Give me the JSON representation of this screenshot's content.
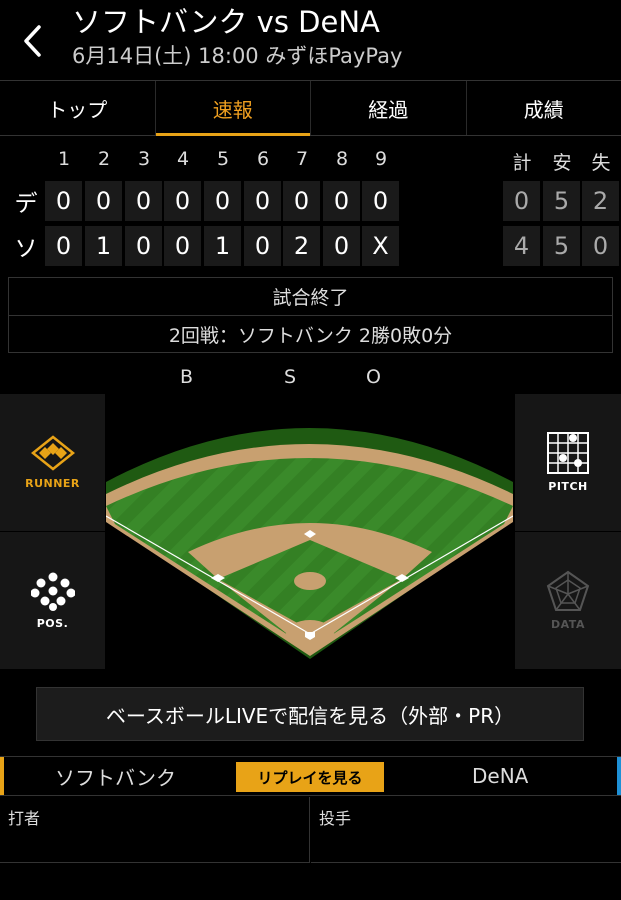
{
  "header": {
    "title": "ソフトバンク vs DeNA",
    "subtitle": "6月14日(土) 18:00 みずほPayPay"
  },
  "tabs": [
    {
      "label": "トップ",
      "active": false
    },
    {
      "label": "速報",
      "active": true
    },
    {
      "label": "経過",
      "active": false
    },
    {
      "label": "成績",
      "active": false
    }
  ],
  "scoreboard": {
    "innings": [
      "1",
      "2",
      "3",
      "4",
      "5",
      "6",
      "7",
      "8",
      "9"
    ],
    "totals_headers": [
      "計",
      "安",
      "失"
    ],
    "teams": [
      {
        "abbr": "デ",
        "scores": [
          "0",
          "0",
          "0",
          "0",
          "0",
          "0",
          "0",
          "0",
          "0"
        ],
        "totals": [
          "0",
          "5",
          "2"
        ]
      },
      {
        "abbr": "ソ",
        "scores": [
          "0",
          "1",
          "0",
          "0",
          "1",
          "0",
          "2",
          "0",
          "X"
        ],
        "totals": [
          "4",
          "5",
          "0"
        ]
      }
    ]
  },
  "status": {
    "line1": "試合終了",
    "line2": "2回戦：ソフトバンク 2勝0敗0分"
  },
  "bso": {
    "b": "B",
    "s": "S",
    "o": "O"
  },
  "side_buttons": {
    "runner": "RUNNER",
    "pitch": "PITCH",
    "pos": "POS.",
    "data": "DATA"
  },
  "live_button": "ベースボールLIVEで配信を見る（外部・PR）",
  "teams_bar": {
    "home": "ソフトバンク",
    "replay": "リプレイを見る",
    "away": "DeNA"
  },
  "batter_pitcher": {
    "batter": "打者",
    "pitcher": "投手"
  },
  "colors": {
    "accent": "#e8a317",
    "away_accent": "#1e90d6",
    "grass": "#3a8a2a",
    "dirt": "#c8a070"
  }
}
